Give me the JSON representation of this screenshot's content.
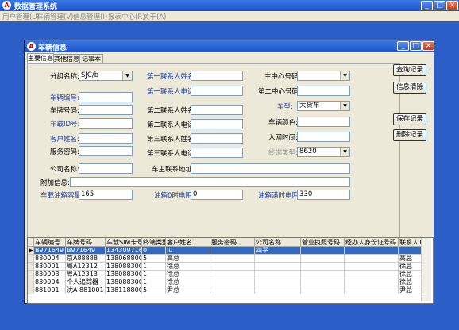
{
  "app": {
    "title": "数据管理系统",
    "icon": "A"
  },
  "menu": [
    "用户管理(U)",
    "车辆管理(V)",
    "信息管理(I)",
    "报表中心(R)",
    "关于(A)"
  ],
  "window_buttons": {
    "min": "_",
    "max": "□",
    "close": "×"
  },
  "child": {
    "title": "车辆信息",
    "icon": "A"
  },
  "tabs": [
    "主要信息",
    "其他信息",
    "记事本"
  ],
  "form": {
    "group_label": "分组名称:",
    "group_value": "SJC/b",
    "veh_no_label": "车辆编号:",
    "veh_no_value": "",
    "plate_label": "车牌号码:",
    "plate_value": "",
    "veh_id_label": "车载ID号:",
    "veh_id_value": "",
    "cust_label": "客户姓名:",
    "cust_value": "",
    "svc_pwd_label": "服务密码:",
    "svc_pwd_value": "",
    "company_label": "公司名称:",
    "company_value": "",
    "extra_label": "附加信息:",
    "extra_value": "",
    "tank_label": "车载油箱容量",
    "tank_value": "165",
    "c1_name_label": "第一联系人姓名",
    "c1_name_value": "",
    "c1_tel_label": "第一联系人电话",
    "c1_tel_value": "",
    "c2_name_label": "第二联系人姓名",
    "c2_name_value": "",
    "c2_tel_label": "第二联系人电话",
    "c2_tel_value": "",
    "c3_name_label": "第三联系人姓名",
    "c3_name_value": "",
    "c3_tel_label": "第三联系人电话",
    "c3_tel_value": "",
    "owner_addr_label": "车主联系地址",
    "owner_addr_value": "",
    "empty_v_label": "油箱0时电阻:",
    "empty_v_value": "0",
    "main1_label": "主中心号码",
    "main1_value": "",
    "main2_label": "第二中心号码",
    "main2_value": "",
    "type_label": "车型:",
    "type_value": "大货车",
    "color_label": "车辆颜色:",
    "color_value": "",
    "entry_label": "入网时间:",
    "entry_value": "",
    "term_label": "终端类型:",
    "term_value": "8620",
    "full_v_label": "油箱满时电阻",
    "full_v_value": "330"
  },
  "buttons": {
    "query": "查询记录",
    "clear": "信息清除",
    "save": "保存记录",
    "delete": "删除记录"
  },
  "grid": {
    "headers": [
      "车辆编号",
      "车牌号码",
      "车载SIM卡号",
      "终端类型",
      "客户姓名",
      "服务密码",
      "公司名称",
      "营业执照号码",
      "经办人身份证号码",
      "联系人1"
    ],
    "rows": [
      [
        "B971649",
        "B971649",
        "13430971649",
        "0",
        "lu",
        "",
        "四平",
        "",
        "",
        ""
      ],
      [
        "880004",
        "京A88888",
        "13806880001",
        "5",
        "高总",
        "",
        "",
        "",
        "",
        "高总"
      ],
      [
        "830001",
        "粤A12312",
        "13808830001",
        "1",
        "徐总",
        "",
        "",
        "",
        "",
        "徐总"
      ],
      [
        "830003",
        "粤A12313",
        "13808830003",
        "1",
        "徐总",
        "",
        "",
        "",
        "",
        "徐总"
      ],
      [
        "830004",
        "个人追踪器",
        "13808830004",
        "1",
        "徐总",
        "",
        "",
        "",
        "",
        "徐总"
      ],
      [
        "881001",
        "沈A 881001",
        "13811880001",
        "5",
        "尹总",
        "",
        "",
        "",
        "",
        "尹总"
      ]
    ]
  }
}
